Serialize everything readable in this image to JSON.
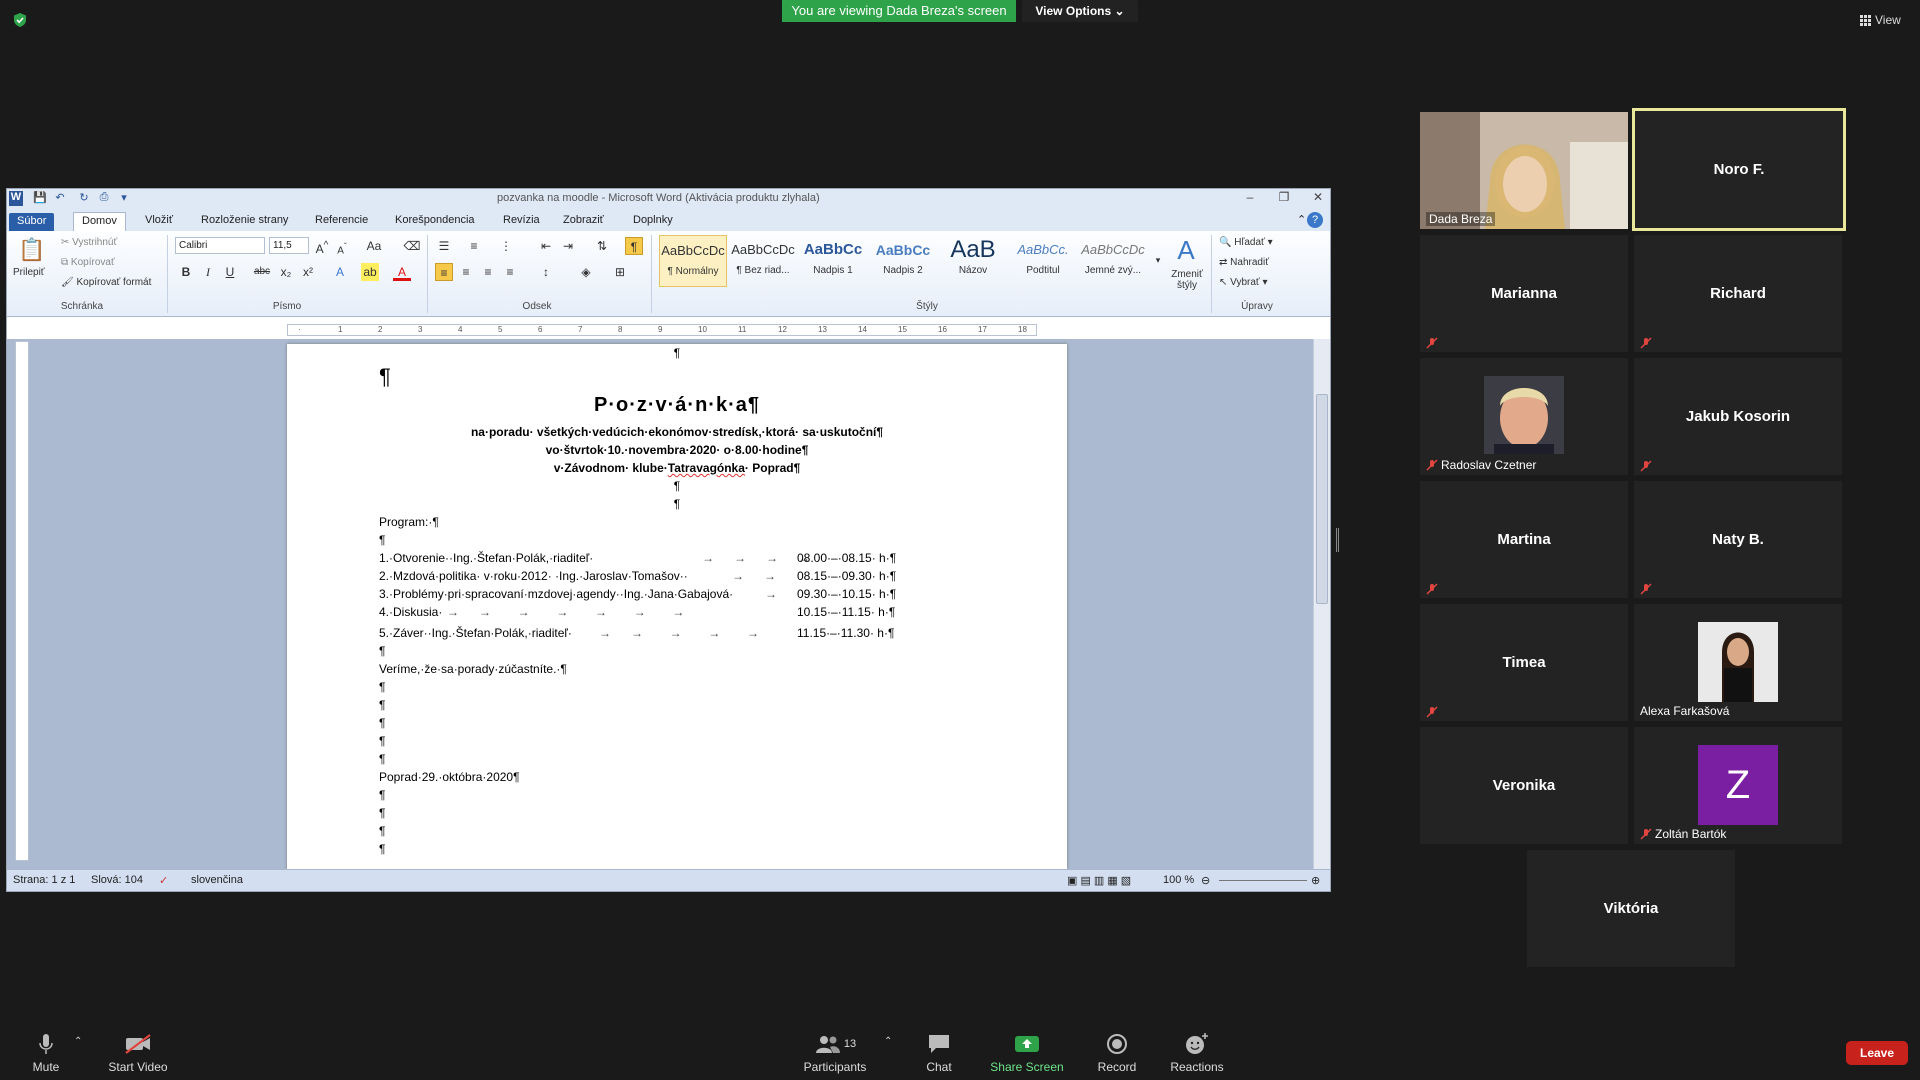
{
  "top_bar": {
    "viewing_banner": "You are viewing Dada Breza's screen",
    "view_options": "View Options",
    "view_label": "View"
  },
  "word": {
    "title": "pozvanka na moodle  -  Microsoft Word (Aktivácia produktu zlyhala)",
    "tabs": [
      "Súbor",
      "Domov",
      "Vložiť",
      "Rozloženie strany",
      "Referencie",
      "Korešpondencia",
      "Revízia",
      "Zobraziť",
      "Doplnky"
    ],
    "ribbon": {
      "clipboard": {
        "paste": "Prilepiť",
        "cut": "Vystrihnúť",
        "copy": "Kopírovať",
        "format_painter": "Kopírovať formát",
        "label": "Schránka"
      },
      "font": {
        "name": "Calibri",
        "size": "11,5",
        "label": "Písmo"
      },
      "paragraph_label": "Odsek",
      "styles": {
        "label": "Štýly",
        "items": [
          {
            "sample": "AaBbCcDc",
            "name": "¶ Normálny"
          },
          {
            "sample": "AaBbCcDc",
            "name": "¶ Bez riad..."
          },
          {
            "sample": "AaBbCc",
            "name": "Nadpis 1"
          },
          {
            "sample": "AaBbCc",
            "name": "Nadpis 2"
          },
          {
            "sample": "AaB",
            "name": "Názov"
          },
          {
            "sample": "AaBbCc.",
            "name": "Podtitul"
          },
          {
            "sample": "AaBbCcDc",
            "name": "Jemné zvý..."
          }
        ],
        "change": "Zmeniť štýly"
      },
      "editing": {
        "find": "Hľadať",
        "replace": "Nahradiť",
        "select": "Vybrať",
        "label": "Úpravy"
      }
    },
    "document": {
      "title": "P·o·z·v·á·n·k·a¶",
      "line1": "na·poradu· všetkých·vedúcich·ekonómov·stredísk,·ktorá· sa·uskutoční¶",
      "line2": "vo·štvrtok·10.·novembra·2020· o·8.00·hodine¶",
      "line3_pre": "v·Závodnom· klube·",
      "line3_sq": "Tatravagónka",
      "line3_post": "· Poprad¶",
      "program": "Program:·¶",
      "items": [
        {
          "text": "1.·Otvorenie··Ing.·Štefan·Polák,·riaditeľ·",
          "time": "08.00·–·08.15· h·¶"
        },
        {
          "text": "2.·Mzdová·politika· v·roku·2012· ·Ing.·Jaroslav·Tomašov··",
          "time": "08.15·–·09.30· h·¶"
        },
        {
          "text": "3.·Problémy·pri·spracovaní·mzdovej·agendy··Ing.·Jana·Gabajová·",
          "time": "09.30·–·10.15· h·¶"
        },
        {
          "text": "4.·Diskusia·",
          "time": "10.15·–·11.15· h·¶"
        },
        {
          "text": "5.·Záver··Ing.·Štefan·Polák,·riaditeľ·",
          "time": "11.15·–·11.30· h·¶"
        }
      ],
      "closing": "Veríme,·že·sa·porady·zúčastníte.·¶",
      "date": "Poprad·29.·októbra·2020¶",
      "pilcrow": "¶"
    },
    "status": {
      "page": "Strana: 1 z 1",
      "words": "Slová: 104",
      "language": "slovenčina",
      "zoom": "100 %"
    }
  },
  "participants": [
    {
      "name": "Dada Breza",
      "video": true,
      "muted": false
    },
    {
      "name": "Noro F.",
      "video": false,
      "muted": false,
      "active_speaker": true
    },
    {
      "name": "Marianna",
      "video": false,
      "muted": true
    },
    {
      "name": "Richard",
      "video": false,
      "muted": true
    },
    {
      "name": "Radoslav Czetner",
      "video": true,
      "muted": true
    },
    {
      "name": "Jakub Kosorin",
      "video": false,
      "muted": true
    },
    {
      "name": "Martina",
      "video": false,
      "muted": true
    },
    {
      "name": "Naty B.",
      "video": false,
      "muted": true
    },
    {
      "name": "Timea",
      "video": false,
      "muted": true
    },
    {
      "name": "Alexa Farkašová",
      "video": true,
      "muted": false
    },
    {
      "name": "Veronika",
      "video": false,
      "muted": false
    },
    {
      "name": "Zoltán Bartók",
      "video": false,
      "muted": true,
      "avatar_letter": "Z",
      "avatar_color": "#7b1fa2"
    },
    {
      "name": "Viktória",
      "video": false,
      "muted": false
    }
  ],
  "toolbar": {
    "mute": "Mute",
    "start_video": "Start Video",
    "participants": "Participants",
    "participants_count": "13",
    "chat": "Chat",
    "share_screen": "Share Screen",
    "record": "Record",
    "reactions": "Reactions",
    "leave": "Leave"
  },
  "colors": {
    "share_green": "#2fa34a",
    "leave_red": "#c8221c",
    "active_border": "#e8e79a"
  }
}
